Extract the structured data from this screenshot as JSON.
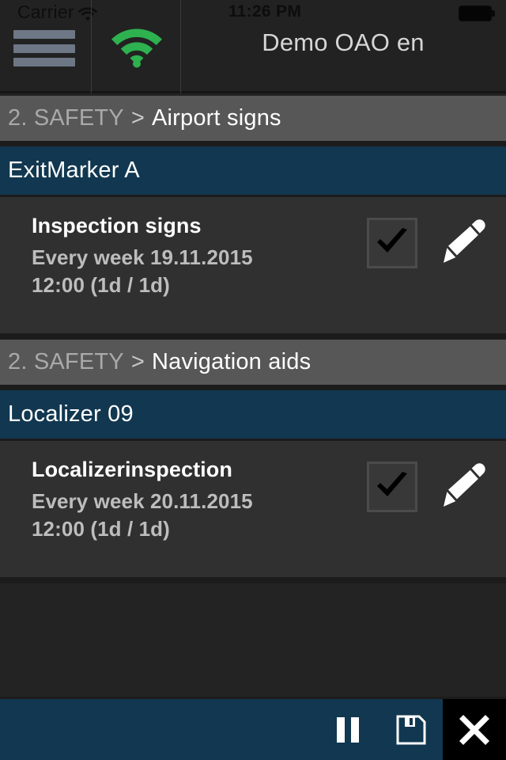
{
  "status_bar": {
    "carrier": "Carrier",
    "wifi_icon": "wifi-icon",
    "time": "11:26 PM",
    "battery_icon": "battery-full-icon"
  },
  "header": {
    "menu_icon": "hamburger-menu-icon",
    "connection_icon": "wifi-signal-icon",
    "connection_color": "#2eb14f",
    "app_title": "Demo OAO en"
  },
  "sections": [
    {
      "breadcrumb_parent": "2. SAFETY",
      "breadcrumb_separator": ">",
      "breadcrumb_current": "Airport signs",
      "object_name": "ExitMarker A",
      "tasks": [
        {
          "title": "Inspection signs",
          "schedule_line1": "Every week 19.11.2015",
          "schedule_line2": "12:00 (1d / 1d)",
          "checkbox_icon": "checkmark-icon",
          "checked": true,
          "edit_icon": "pencil-icon"
        }
      ]
    },
    {
      "breadcrumb_parent": "2. SAFETY",
      "breadcrumb_separator": ">",
      "breadcrumb_current": "Navigation aids",
      "object_name": "Localizer 09",
      "tasks": [
        {
          "title": "Localizerinspection",
          "schedule_line1": "Every week 20.11.2015",
          "schedule_line2": "12:00 (1d / 1d)",
          "checkbox_icon": "checkmark-icon",
          "checked": true,
          "edit_icon": "pencil-icon"
        }
      ]
    }
  ],
  "bottom_bar": {
    "background_color": "#123750",
    "buttons": [
      {
        "name": "pause-button",
        "icon": "pause-icon"
      },
      {
        "name": "save-button",
        "icon": "floppy-disk-icon"
      },
      {
        "name": "close-button",
        "icon": "close-x-icon"
      }
    ]
  },
  "colors": {
    "accent_blue": "#123750",
    "breadcrumb_gray": "#575757",
    "row_gray": "#303030",
    "page_background": "#232323",
    "menu_icon": "#6d7785"
  }
}
